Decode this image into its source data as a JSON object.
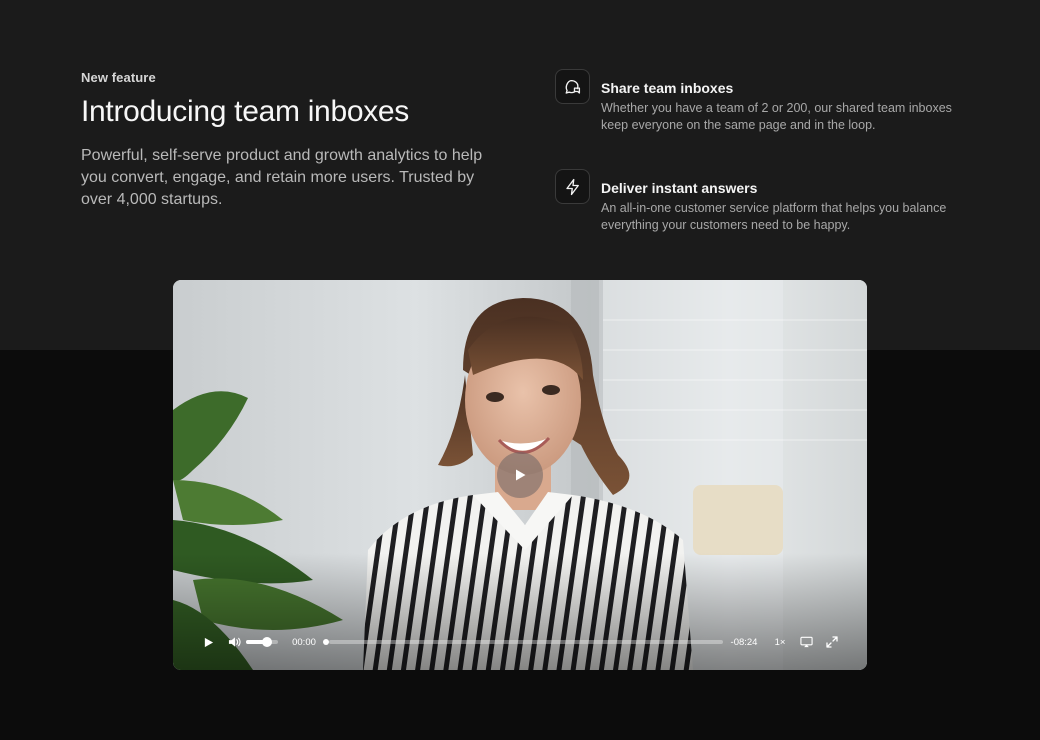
{
  "intro": {
    "eyebrow": "New feature",
    "headline": "Introducing team inboxes",
    "lede": "Powerful, self-serve product and growth analytics to help you convert, engage, and retain more users. Trusted by over 4,000 startups."
  },
  "features": [
    {
      "icon": "message-chat-icon",
      "title": "Share team inboxes",
      "description": "Whether you have a team of 2 or 200, our shared team inboxes keep everyone on the same page and in the loop."
    },
    {
      "icon": "lightning-bolt-icon",
      "title": "Deliver instant answers",
      "description": "An all-in-one customer service platform that helps you balance everything your customers need to be happy."
    }
  ],
  "video": {
    "current_time": "00:00",
    "remaining_time": "-08:24",
    "playback_speed": "1×",
    "volume_level": 0.65,
    "progress": 0.0
  },
  "colors": {
    "top_background": "#1b1b1b",
    "page_background": "#0c0c0c",
    "text_primary": "#f5f5f5",
    "text_secondary": "#a8a8a8"
  }
}
